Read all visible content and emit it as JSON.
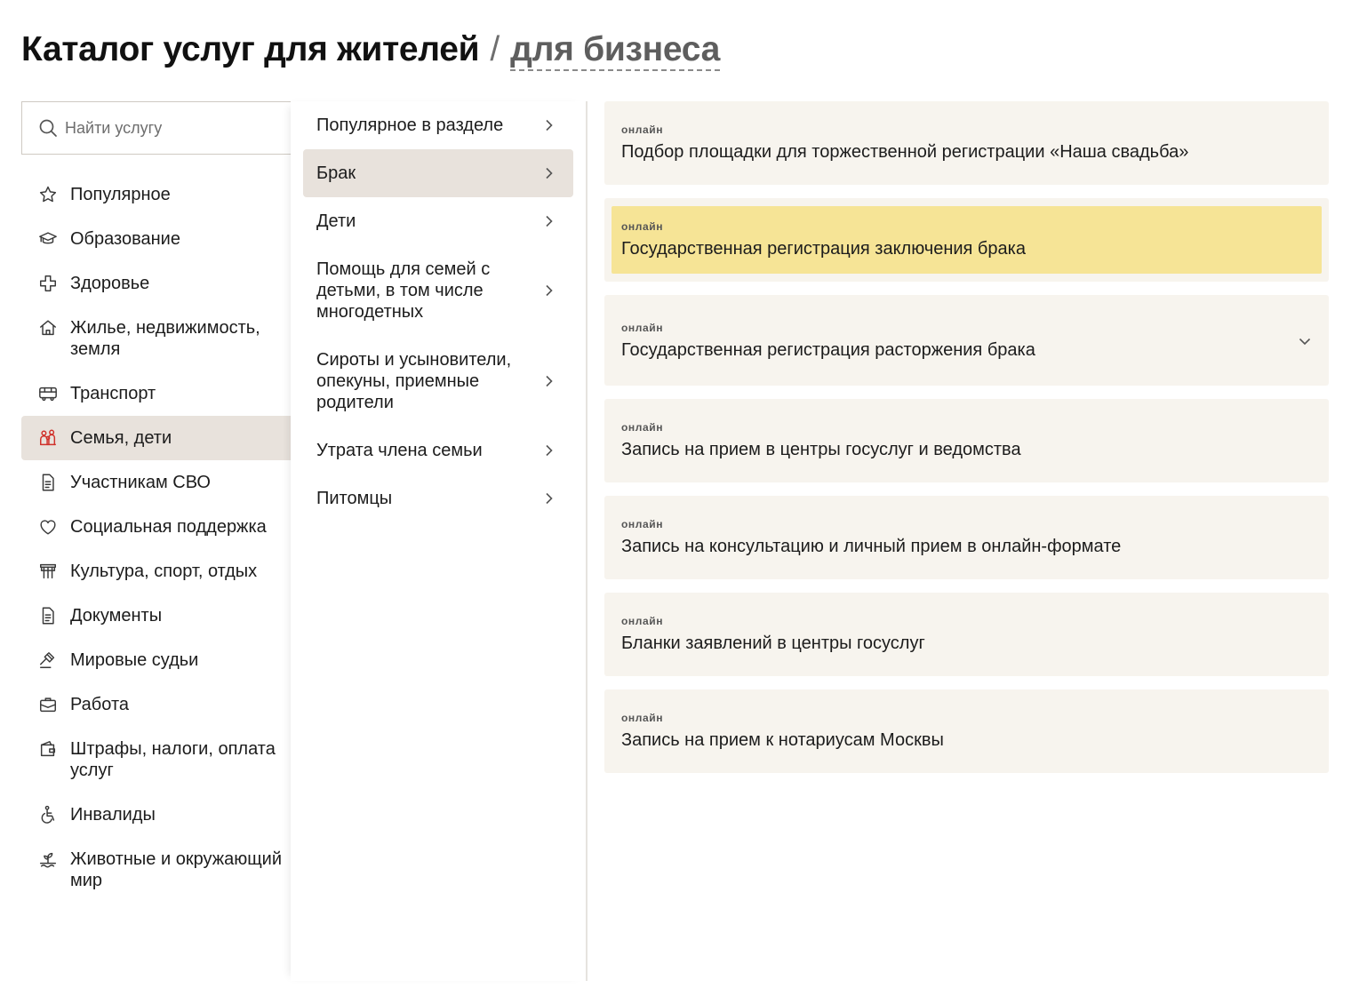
{
  "header": {
    "title": "Каталог услуг для жителей",
    "separator": "/",
    "alt_link": "для бизнеса"
  },
  "search": {
    "placeholder": "Найти услугу"
  },
  "categories": [
    {
      "label": "Популярное",
      "icon": "star-icon"
    },
    {
      "label": "Образование",
      "icon": "graduation-cap-icon"
    },
    {
      "label": "Здоровье",
      "icon": "medical-cross-icon"
    },
    {
      "label": "Жилье, недвижимость, земля",
      "icon": "house-icon"
    },
    {
      "label": "Транспорт",
      "icon": "bus-icon"
    },
    {
      "label": "Семья, дети",
      "icon": "family-icon",
      "active": true
    },
    {
      "label": "Участникам СВО",
      "icon": "document-icon"
    },
    {
      "label": "Социальная поддержка",
      "icon": "heart-icon"
    },
    {
      "label": "Культура, спорт, отдых",
      "icon": "theater-icon"
    },
    {
      "label": "Документы",
      "icon": "document-icon"
    },
    {
      "label": "Мировые судьи",
      "icon": "gavel-icon"
    },
    {
      "label": "Работа",
      "icon": "briefcase-icon"
    },
    {
      "label": "Штрафы, налоги, оплата услуг",
      "icon": "wallet-icon"
    },
    {
      "label": "Инвалиды",
      "icon": "wheelchair-icon"
    },
    {
      "label": "Животные и окружающий мир",
      "icon": "sprout-icon"
    }
  ],
  "subcategories": [
    {
      "label": "Популярное в разделе"
    },
    {
      "label": "Брак",
      "active": true
    },
    {
      "label": "Дети"
    },
    {
      "label": "Помощь для семей с детьми, в том числе многодетных"
    },
    {
      "label": "Сироты и усыновители, опекуны, приемные родители"
    },
    {
      "label": "Утрата члена семьи"
    },
    {
      "label": "Питомцы"
    }
  ],
  "services": [
    {
      "tag": "онлайн",
      "title": "Подбор площадки для торжественной регистрации «Наша свадьба»"
    },
    {
      "tag": "онлайн",
      "title": "Государственная регистрация заключения брака",
      "highlight": true
    },
    {
      "tag": "онлайн",
      "title": "Государственная регистрация расторжения брака",
      "expandable": true
    },
    {
      "tag": "онлайн",
      "title": "Запись на прием в центры госуслуг и ведомства"
    },
    {
      "tag": "онлайн",
      "title": "Запись на консультацию и личный прием в онлайн-формате"
    },
    {
      "tag": "онлайн",
      "title": "Бланки заявлений в центры госуслуг"
    },
    {
      "tag": "онлайн",
      "title": "Запись на прием к нотариусам Москвы"
    }
  ],
  "colors": {
    "active_bg": "#e8e2dc",
    "card_bg": "#f7f4ee",
    "highlight": "#f6e496",
    "accent_red": "#d0302a"
  }
}
